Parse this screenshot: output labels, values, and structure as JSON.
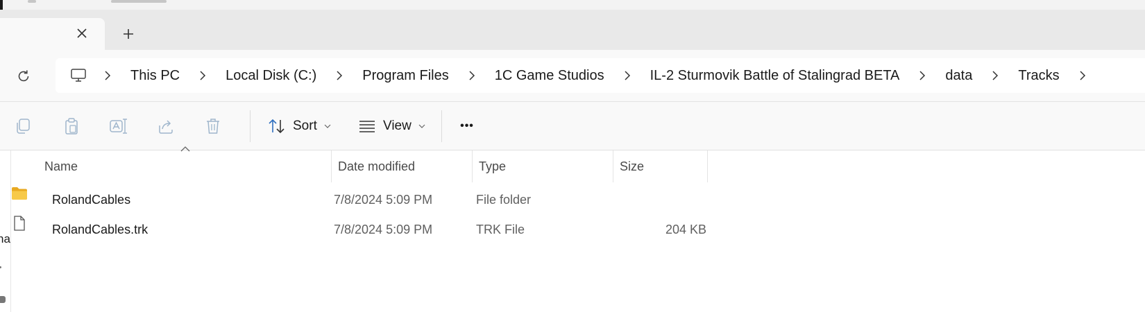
{
  "tab": {
    "close_label": "×",
    "new_label": "+"
  },
  "address": {
    "breadcrumbs": [
      "This PC",
      "Local Disk (C:)",
      "Program Files",
      "1C Game Studios",
      "IL-2 Sturmovik Battle of Stalingrad BETA",
      "data",
      "Tracks"
    ]
  },
  "toolbar": {
    "sort_label": "Sort",
    "view_label": "View",
    "more_label": "•••",
    "icons": [
      "copy-icon",
      "paste-icon",
      "rename-icon",
      "share-icon",
      "delete-icon"
    ]
  },
  "columns": {
    "name": "Name",
    "date": "Date modified",
    "type": "Type",
    "size": "Size"
  },
  "files": [
    {
      "name": "RolandCables",
      "date": "7/8/2024 5:09 PM",
      "type": "File folder",
      "size": "",
      "icon": "folder-icon"
    },
    {
      "name": "RolandCables.trk",
      "date": "7/8/2024 5:09 PM",
      "type": "TRK File",
      "size": "204 KB",
      "icon": "file-icon"
    }
  ],
  "nav_pane": {
    "partial_label": "na"
  },
  "colors": {
    "accent": "#2f6fbf",
    "folder": "#f7c948",
    "disabled_icon": "#9fb6cc",
    "tabbar_bg": "#e9e9e9",
    "surface": "#f9f9f9"
  }
}
